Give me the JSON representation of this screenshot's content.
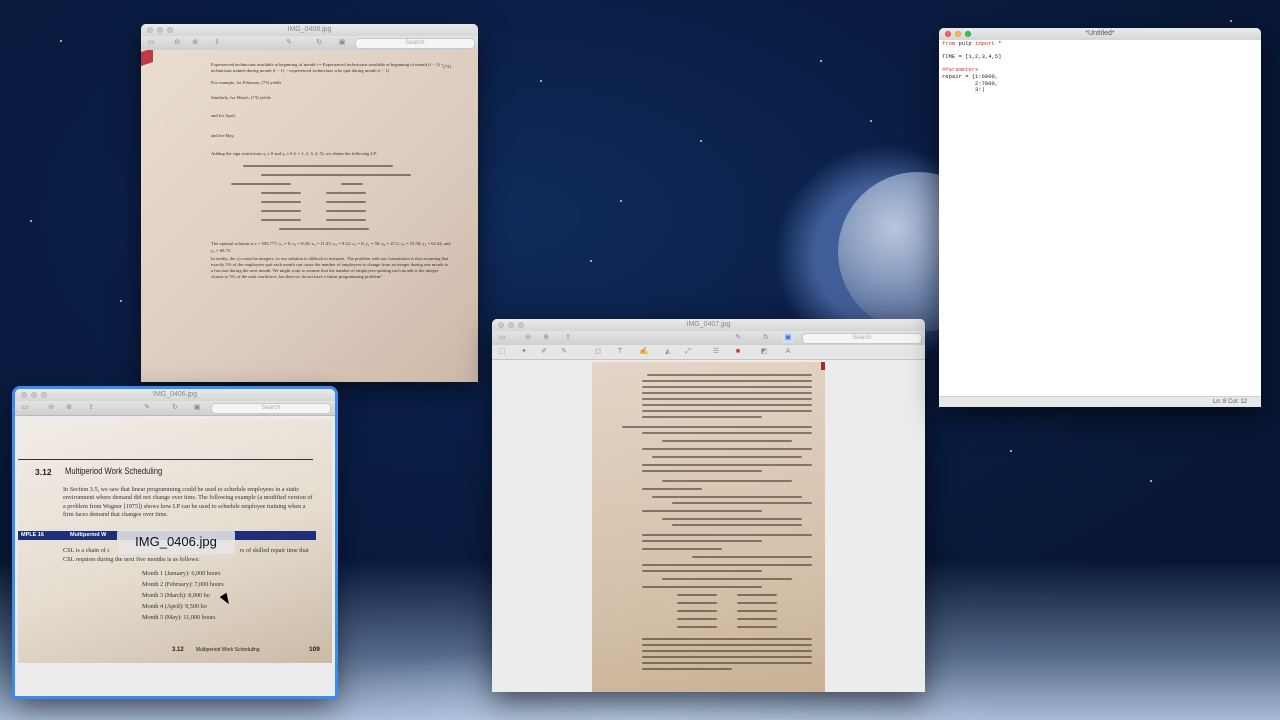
{
  "desktop": {
    "wallpaper": "space-earth-moon"
  },
  "windows": {
    "img0408": {
      "title": "IMG_0408.jpg",
      "search_placeholder": "Search",
      "doc": {
        "heading_text": "Experienced technicians available at beginning of month t = Experienced technicians available at beginning of month (t − 1) + technicians trained during month (t − 1) − experienced technicians who quit during month (t − 1)",
        "eq_number": "(73)",
        "p1": "For example, for February, (73) yields",
        "p2": "Similarly, for March, (73) yields",
        "p3": "and for April,",
        "p4": "and for May,",
        "p5": "Adding the sign restrictions xᵢ ≥ 0 and yᵢ ≥ 0 (i = 1, 2, 3, 4, 5), we obtain the following LP:",
        "p6": "The optimal solution is z = 593,777; x₁ = 0; x₂ = 8.45; x₃ = 11.45; x₄ = 9.52; x₅ = 0; y₁ = 50; y₂ = 47.5; y₃ = 53.58; y₄ = 62.34; and y₅ = 68.75.",
        "p7": "In reality, the yᵢ's must be integers, so our solution is difficult to interpret. The problem with our formulation is that assuming that exactly 5% of the employees quit each month can cause the number of employees to change from an integer during one month to a fraction during the next month. We might want to assume that the number of employees quitting each month is the integer closest to 5% of the total workforce, but then we do not have a linear programming problem!"
      }
    },
    "img0406": {
      "title": "IMG_0406.jpg",
      "search_placeholder": "Search",
      "tooltip": "IMG_0406.jpg",
      "doc": {
        "section_number": "3.12",
        "section_title": "Multiperiod Work Scheduling",
        "intro": "In Section 3.5, we saw that linear programming could be used to schedule employees in a static environment where demand did not change over time. The following example (a modified version of a problem from Wagner [1975]) shows how LP can be used to schedule employee training when a firm faces demand that changes over time.",
        "example_label": "MPLE 16",
        "example_title": "Multiperiod W",
        "body_a": "CSL is a chain of c",
        "body_b": "rs of skilled repair time that",
        "body_c": "CSL requires during the next five months is as follows:",
        "months": [
          "Month 1 (January): 6,000 hours",
          "Month 2 (February): 7,000 hours",
          "Month 3 (March): 8,000 ho",
          "Month 4 (April): 9,500 ho",
          "Month 5 (May): 11,000 hours"
        ],
        "footer_section": "3.12",
        "footer_title": "Multiperiod Work Scheduling",
        "page_number": "109"
      }
    },
    "img0407": {
      "title": "IMG_0407.jpg",
      "search_placeholder": "Search"
    },
    "untitled": {
      "title": "*Untitled*",
      "code_line1_kw1": "from",
      "code_line1_mid": " pulp ",
      "code_line1_kw2": "import",
      "code_line1_end": " *",
      "code_line2": "TIME = [1,2,3,4,5]",
      "code_line3": "#Parameters",
      "code_line4": "repair = {1:6000,",
      "code_line5": "          2:7000,",
      "code_line6": "          3:|",
      "status": "Ln: 8   Col: 12"
    }
  }
}
